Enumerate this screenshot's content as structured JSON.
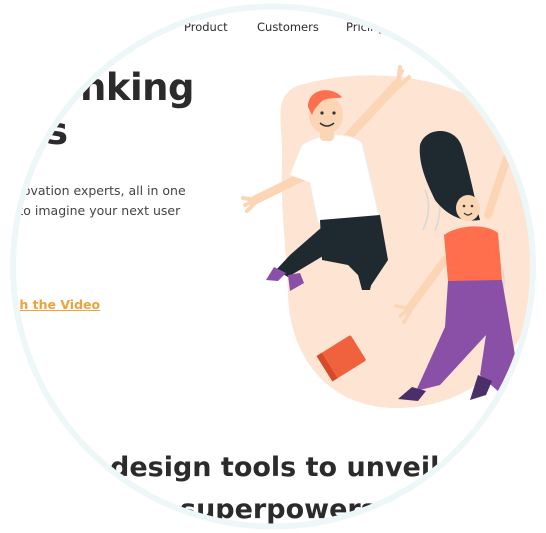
{
  "nav": {
    "items": [
      {
        "label": "Product"
      },
      {
        "label": "Customers"
      },
      {
        "label": "Pricing"
      }
    ]
  },
  "hero": {
    "title_line1": "hinking",
    "title_line2": "s",
    "description_line1": "nnovation experts, all in one",
    "description_line2": "y to imagine your next user",
    "video_link": "tch the Video"
  },
  "section": {
    "heading_line1": "design tools to unveil",
    "heading_line2": "superpowers"
  },
  "colors": {
    "accent_orange": "#f0a23a",
    "blob_peach": "#fde4d3",
    "shirt_coral": "#ff6f4d",
    "pants_purple": "#8a4fa6",
    "text_dark": "#2b2b2b"
  },
  "icons": [
    "jumping-people-illustration",
    "book-icon"
  ]
}
